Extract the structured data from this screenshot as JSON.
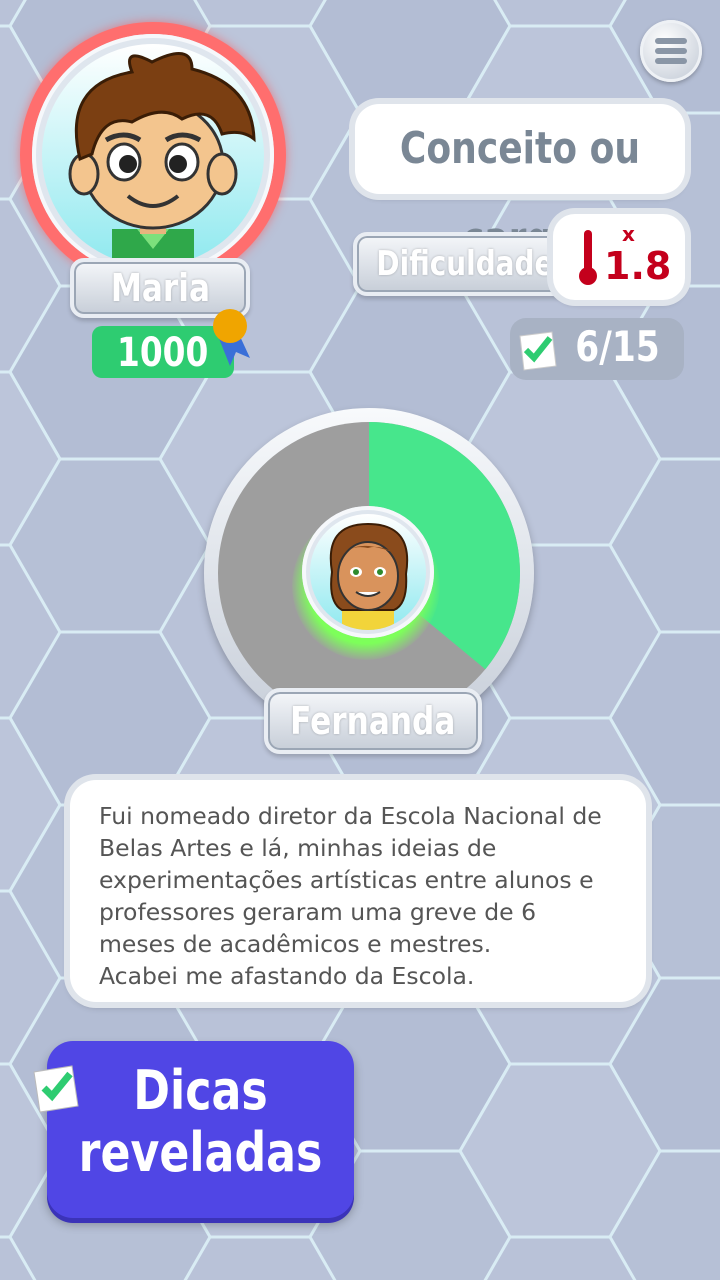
{
  "player": {
    "name": "Maria",
    "score": "1000"
  },
  "menu": {
    "icon": "hamburger-menu-icon"
  },
  "category": {
    "label": "Conceito ou cargo"
  },
  "difficulty": {
    "label": "Dificuldade",
    "multiplier_symbol": "x",
    "value": "1.8",
    "icon": "thermometer-icon",
    "color": "#c4001c"
  },
  "progress": {
    "text": "6/15",
    "icon": "checklist-icon"
  },
  "timer": {
    "remaining_fraction": 0.36,
    "accent": "#47e68c",
    "track": "#9e9e9e"
  },
  "opponent": {
    "name": "Fernanda"
  },
  "hint": {
    "lines": [
      "Fui nomeado diretor da Escola Nacional de",
      "Belas Artes e lá, minhas ideias de",
      "experimentações artísticas entre alunos e",
      "professores geraram uma greve de 6",
      "meses de acadêmicos e mestres.",
      "Acabei me afastando da Escola."
    ]
  },
  "hints_button": {
    "line1": "Dicas",
    "line2": "reveladas",
    "color": "#5046e5"
  }
}
